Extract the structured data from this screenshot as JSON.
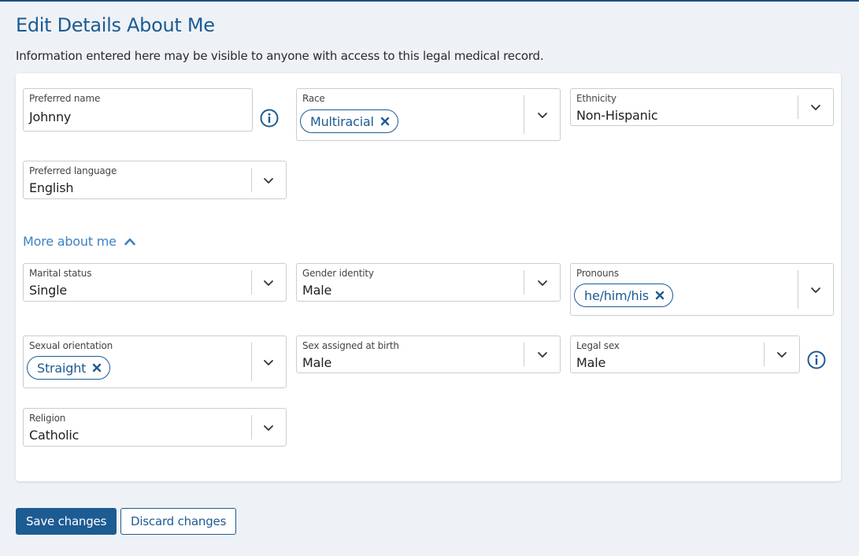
{
  "header": {
    "title": "Edit Details About Me",
    "subtitle": "Information entered here may be visible to anyone with access to this legal medical record."
  },
  "fields": {
    "preferred_name": {
      "label": "Preferred name",
      "value": "Johnny"
    },
    "race": {
      "label": "Race",
      "chip": "Multiracial"
    },
    "ethnicity": {
      "label": "Ethnicity",
      "value": "Non-Hispanic"
    },
    "preferred_language": {
      "label": "Preferred language",
      "value": "English"
    },
    "marital_status": {
      "label": "Marital status",
      "value": "Single"
    },
    "gender_identity": {
      "label": "Gender identity",
      "value": "Male"
    },
    "pronouns": {
      "label": "Pronouns",
      "chip": "he/him/his"
    },
    "sexual_orientation": {
      "label": "Sexual orientation",
      "chip": "Straight"
    },
    "sex_assigned_at_birth": {
      "label": "Sex assigned at birth",
      "value": "Male"
    },
    "legal_sex": {
      "label": "Legal sex",
      "value": "Male"
    },
    "religion": {
      "label": "Religion",
      "value": "Catholic"
    }
  },
  "more_about_me": {
    "label": "More about me",
    "expanded": true
  },
  "actions": {
    "save_label": "Save changes",
    "discard_label": "Discard changes"
  },
  "colors": {
    "accent": "#1d5b93",
    "link": "#3b83c0",
    "background": "#eef2f6"
  },
  "icons": {
    "info": "info-circle-icon",
    "dropdown": "chevron-down-icon",
    "remove_chip": "close-icon",
    "collapse": "chevron-up-icon"
  }
}
